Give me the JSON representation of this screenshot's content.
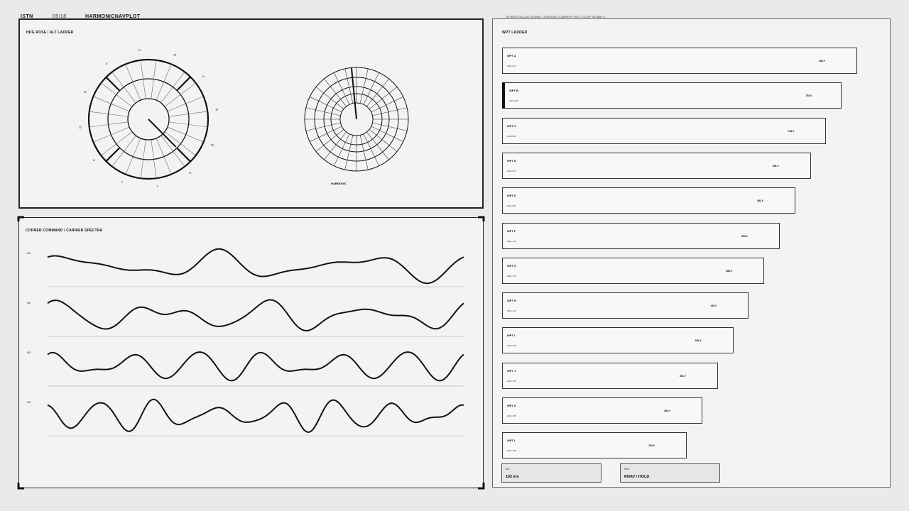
{
  "header": {
    "id": "ISTN",
    "page": "05/18",
    "title": "HARMONICNAVPLOT",
    "subtitle": "INTERSTELLAR SIGNAL TRACKING   CARRIER HST  /  LOOP 38.88M S"
  },
  "rose_panel": {
    "title": "HDG ROSE  /  ALT LADDER",
    "caption": "HARMONIC",
    "rose_labels": [
      "11",
      "14",
      "H",
      "16",
      "13",
      "H",
      "3",
      "4",
      "8",
      "12",
      "13",
      "5"
    ]
  },
  "spectra_panel": {
    "title": "CORNER COMMAND  /  CARRIER SPECTRA",
    "traces": [
      {
        "label": "H1",
        "freq": [
          3.0,
          5.0,
          7.0
        ],
        "amp": [
          0.45,
          0.3,
          0.15
        ],
        "phase": [
          0.2,
          1.1,
          2.3
        ]
      },
      {
        "label": "H2",
        "freq": [
          4.0,
          6.0,
          9.0
        ],
        "amp": [
          0.5,
          0.3,
          0.12
        ],
        "phase": [
          1.0,
          0.4,
          1.7
        ]
      },
      {
        "label": "H3",
        "freq": [
          6.0,
          8.0,
          10.0
        ],
        "amp": [
          0.55,
          0.25,
          0.1
        ],
        "phase": [
          0.5,
          2.0,
          1.0
        ]
      },
      {
        "label": "H4",
        "freq": [
          7.0,
          9.0,
          12.0
        ],
        "amp": [
          0.55,
          0.25,
          0.12
        ],
        "phase": [
          2.5,
          0.3,
          1.5
        ]
      }
    ]
  },
  "ladder": {
    "title": "WPT LADDER",
    "items": [
      {
        "name": "WPT A",
        "hdg": "HDG 017",
        "dist": "38LY"
      },
      {
        "name": "WPT B",
        "hdg": "HDG 034",
        "dist": "75LY",
        "active": true
      },
      {
        "name": "WPT C",
        "hdg": "HDG 052",
        "dist": "78LY"
      },
      {
        "name": "WPT D",
        "hdg": "HDG 079",
        "dist": "45LY"
      },
      {
        "name": "WPT E",
        "hdg": "HDG 087",
        "dist": "38LY"
      },
      {
        "name": "WPT F",
        "hdg": "HDG 103",
        "dist": "35LY"
      },
      {
        "name": "WPT G",
        "hdg": "HDG 119",
        "dist": "58LY"
      },
      {
        "name": "WPT H",
        "hdg": "HDG 131",
        "dist": "45LY"
      },
      {
        "name": "WPT I",
        "hdg": "HDG 158",
        "dist": "68LY"
      },
      {
        "name": "WPT J",
        "hdg": "HDG 165",
        "dist": "35LY"
      },
      {
        "name": "WPT K",
        "hdg": "HDG 188",
        "dist": "38LY"
      },
      {
        "name": "WPT L",
        "hdg": "HDG 195",
        "dist": "25LY"
      }
    ],
    "alt_label": "ALT",
    "alt_value": "192 km",
    "nav_label": "NAV",
    "nav_value": "RNAV / HOLD"
  }
}
